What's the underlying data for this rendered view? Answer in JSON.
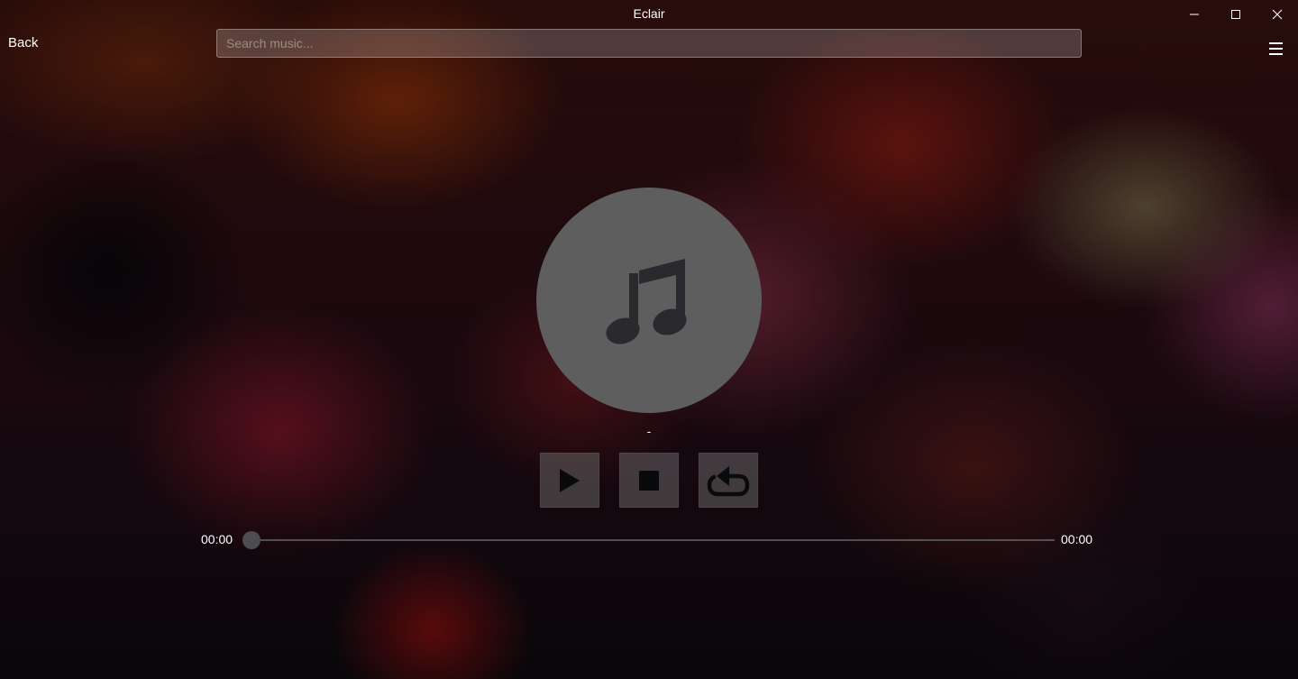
{
  "window": {
    "title": "Eclair",
    "controls": [
      "minimize-icon",
      "maximize-icon",
      "close-icon"
    ]
  },
  "toolbar": {
    "back_label": "Back",
    "search_placeholder": "Search music...",
    "search_value": "",
    "menu_icon": "hamburger-menu-icon"
  },
  "player": {
    "album_art_icon": "music-note-icon",
    "track_title": "-",
    "controls": {
      "play_icon": "play-icon",
      "stop_icon": "stop-icon",
      "loop_icon": "loop-icon"
    },
    "current_time": "00:00",
    "total_time": "00:00",
    "progress": 0
  },
  "colors": {
    "album_art_bg": "#5e5e5e",
    "icon_dark": "#2a2a2e",
    "text": "#ffffff"
  }
}
